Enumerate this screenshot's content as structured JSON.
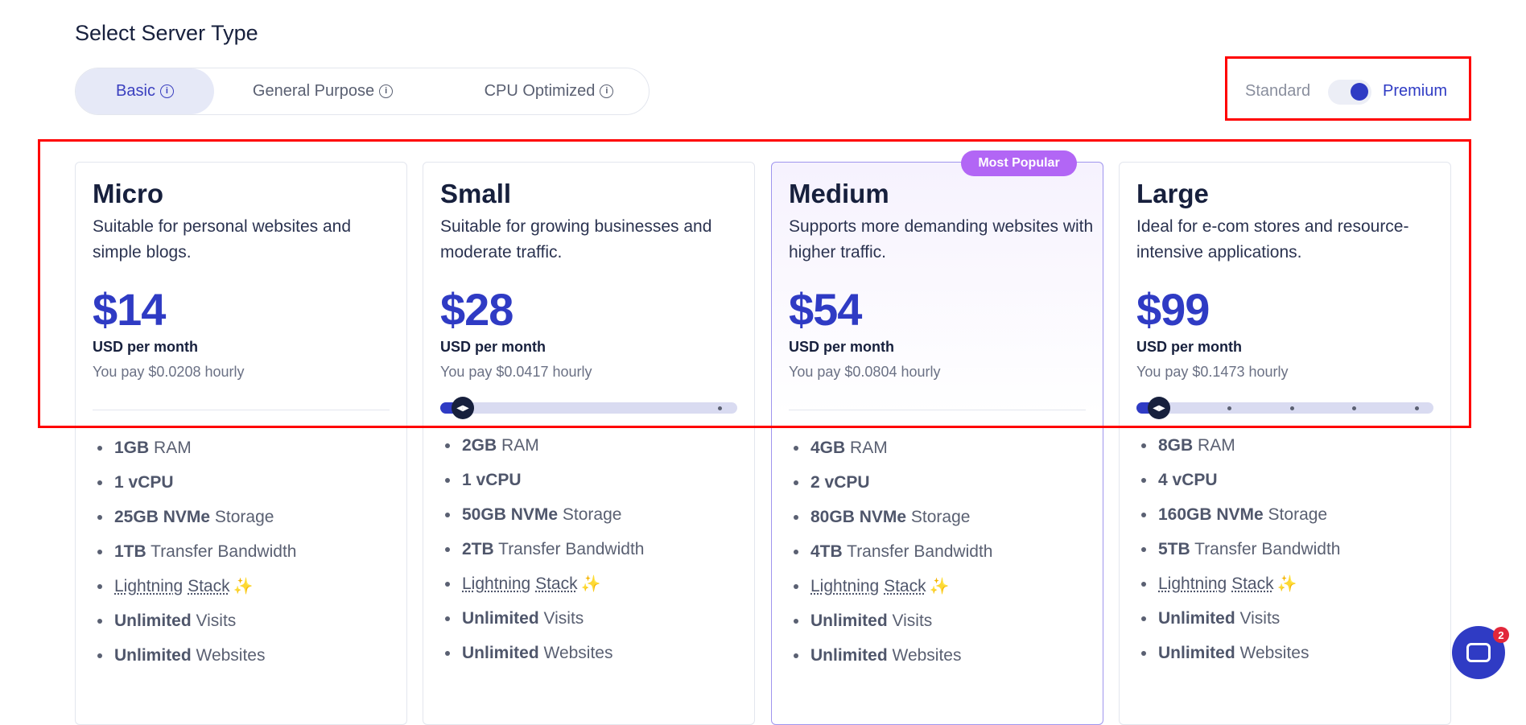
{
  "page_title": "Select Server Type",
  "tabs": [
    {
      "label": "Basic",
      "icon": "info-icon",
      "active": true
    },
    {
      "label": "General Purpose",
      "icon": "info-icon",
      "active": false
    },
    {
      "label": "CPU Optimized",
      "icon": "info-icon",
      "active": false
    }
  ],
  "tier_toggle": {
    "left_label": "Standard",
    "right_label": "Premium",
    "selected": "Premium"
  },
  "badge": "Most Popular",
  "plans": [
    {
      "name": "Micro",
      "description": "Suitable for personal websites and simple blogs.",
      "price": "$14",
      "unit": "USD per month",
      "hourly": "You pay $0.0208 hourly",
      "features": [
        {
          "bold": "1GB",
          "rest": " RAM"
        },
        {
          "bold": "1 vCPU",
          "rest": ""
        },
        {
          "bold": "25GB NVMe",
          "rest": " Storage"
        },
        {
          "bold": "1TB",
          "rest": " Transfer Bandwidth"
        },
        {
          "bold": "Unlimited",
          "rest": " Visits"
        },
        {
          "bold": "Unlimited",
          "rest": " Websites"
        }
      ],
      "lightning": {
        "a": "Lightning",
        "b": "Stack"
      }
    },
    {
      "name": "Small",
      "description": "Suitable for growing businesses and moderate traffic.",
      "price": "$28",
      "unit": "USD per month",
      "hourly": "You pay $0.0417 hourly",
      "features": [
        {
          "bold": "2GB",
          "rest": " RAM"
        },
        {
          "bold": "1 vCPU",
          "rest": ""
        },
        {
          "bold": "50GB NVMe",
          "rest": " Storage"
        },
        {
          "bold": "2TB",
          "rest": " Transfer Bandwidth"
        },
        {
          "bold": "Unlimited",
          "rest": " Visits"
        },
        {
          "bold": "Unlimited",
          "rest": " Websites"
        }
      ],
      "lightning": {
        "a": "Lightning",
        "b": "Stack"
      }
    },
    {
      "name": "Medium",
      "description": "Supports more demanding websites with higher traffic.",
      "price": "$54",
      "unit": "USD per month",
      "hourly": "You pay $0.0804 hourly",
      "features": [
        {
          "bold": "4GB",
          "rest": " RAM"
        },
        {
          "bold": "2 vCPU",
          "rest": ""
        },
        {
          "bold": "80GB NVMe",
          "rest": " Storage"
        },
        {
          "bold": "4TB",
          "rest": " Transfer Bandwidth"
        },
        {
          "bold": "Unlimited",
          "rest": " Visits"
        },
        {
          "bold": "Unlimited",
          "rest": " Websites"
        }
      ],
      "lightning": {
        "a": "Lightning",
        "b": "Stack"
      }
    },
    {
      "name": "Large",
      "description": "Ideal for e-com stores and resource-intensive applications.",
      "price": "$99",
      "unit": "USD per month",
      "hourly": "You pay $0.1473 hourly",
      "features": [
        {
          "bold": "8GB",
          "rest": " RAM"
        },
        {
          "bold": "4 vCPU",
          "rest": ""
        },
        {
          "bold": "160GB NVMe",
          "rest": " Storage"
        },
        {
          "bold": "5TB",
          "rest": " Transfer Bandwidth"
        },
        {
          "bold": "Unlimited",
          "rest": " Visits"
        },
        {
          "bold": "Unlimited",
          "rest": " Websites"
        }
      ],
      "lightning": {
        "a": "Lightning",
        "b": "Stack"
      }
    }
  ],
  "chat_badge_count": "2",
  "colors": {
    "accent": "#2f3bc4",
    "badge": "#b266f5",
    "highlight_box": "#ff0000"
  }
}
